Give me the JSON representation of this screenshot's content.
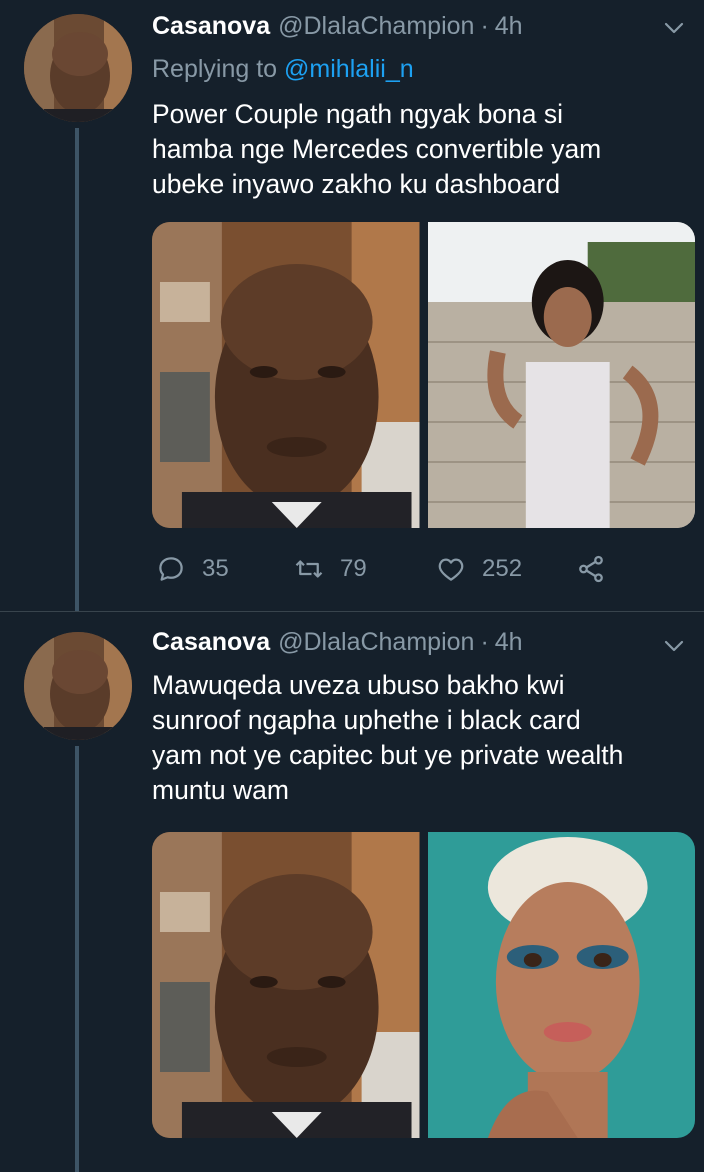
{
  "colors": {
    "background": "#15202b",
    "secondary_text": "#8899a6",
    "link": "#1da1f2",
    "separator": "#38444d",
    "thread_line": "#3d5466"
  },
  "tweets": [
    {
      "display_name": "Casanova",
      "handle": "@DlalaChampion",
      "separator": "·",
      "time": "4h",
      "replying_prefix": "Replying to",
      "replying_to": "@mihlalii_n",
      "lines": [
        "Power Couple ngath ngyak bona si",
        "hamba nge Mercedes convertible yam",
        "ubeke inyawo zakho ku dashboard"
      ],
      "media": [
        "photo-of-man",
        "photo-of-woman-in-white-gown"
      ],
      "actions": {
        "reply_count": "35",
        "retweet_count": "79",
        "like_count": "252"
      },
      "icons": [
        "reply-icon",
        "retweet-icon",
        "like-icon",
        "share-icon",
        "chevron-down-icon"
      ]
    },
    {
      "display_name": "Casanova",
      "handle": "@DlalaChampion",
      "separator": "·",
      "time": "4h",
      "lines": [
        "Mawuqeda uveza ubuso bakho kwi",
        "sunroof ngapha uphethe i black card",
        "yam not ye capitec but ye private wealth",
        "muntu wam"
      ],
      "media": [
        "photo-of-man",
        "photo-of-woman-with-blue-eyeshadow"
      ],
      "icons": [
        "chevron-down-icon"
      ]
    }
  ]
}
